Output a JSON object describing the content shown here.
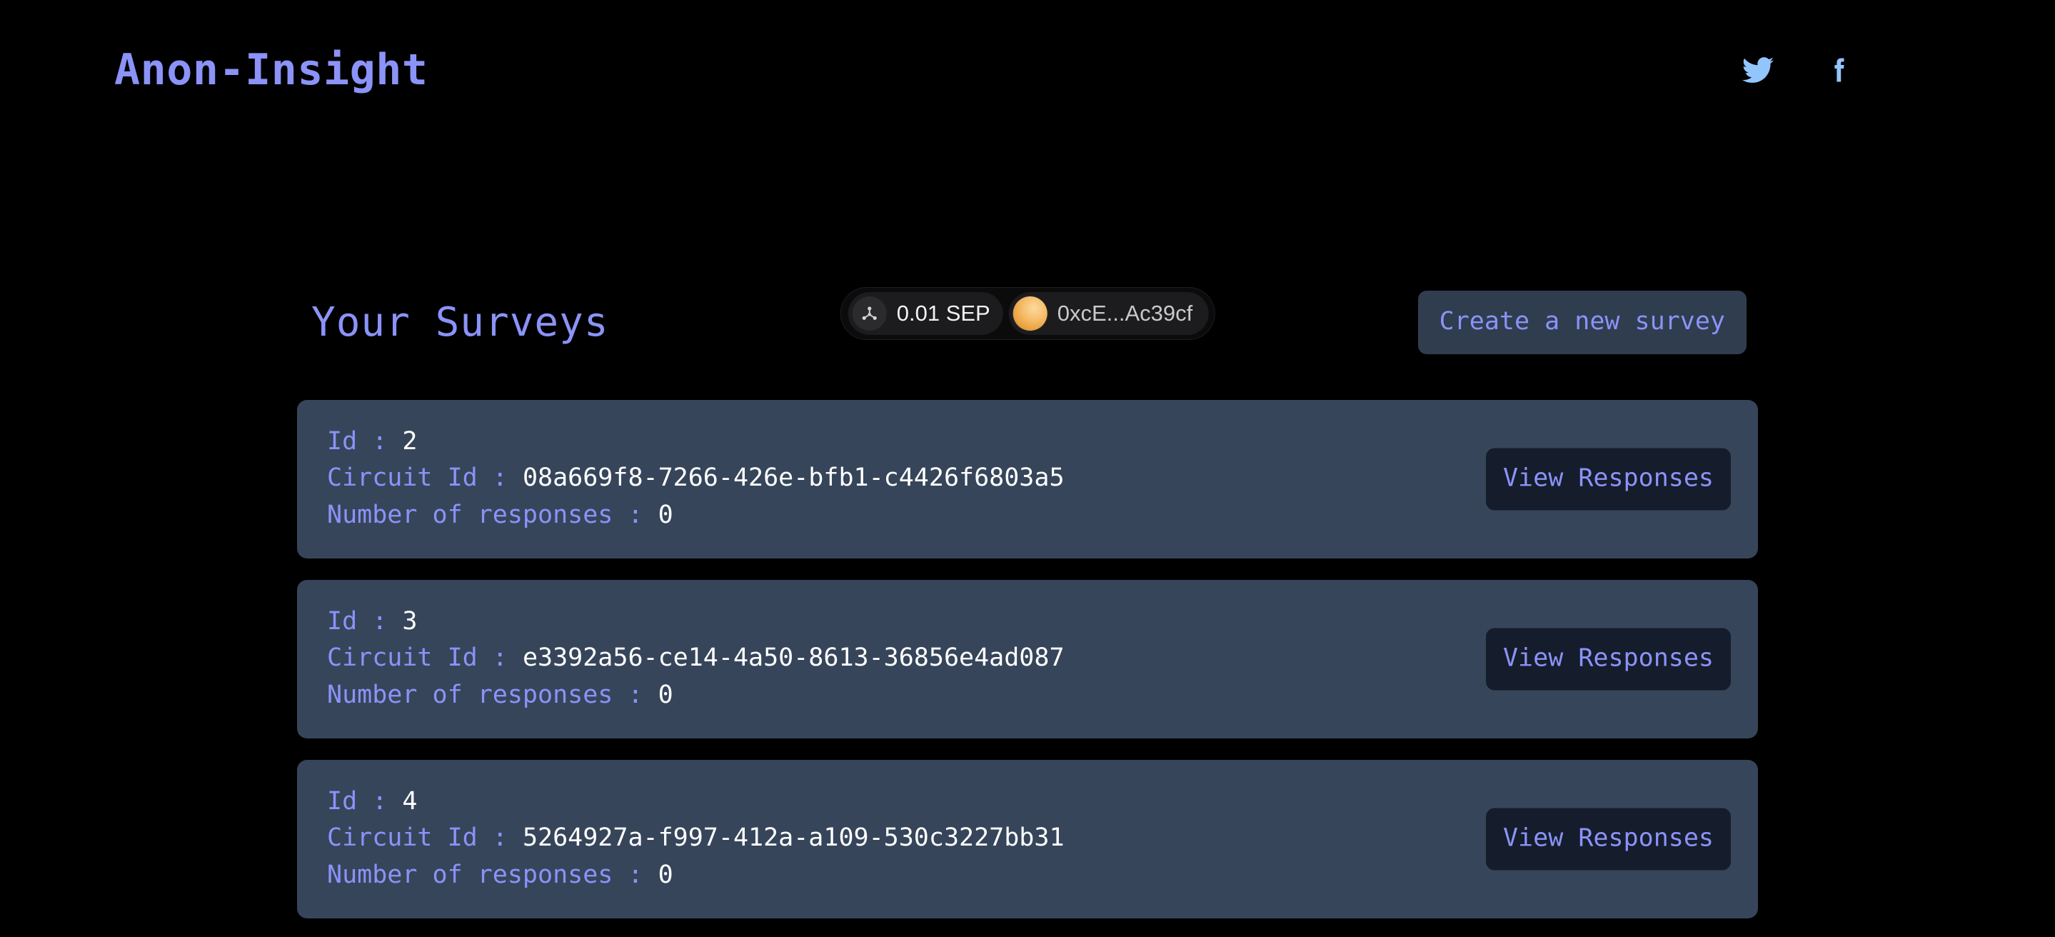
{
  "header": {
    "brand": "Anon-Insight",
    "social": [
      {
        "name": "twitter-icon",
        "label": "Twitter",
        "color": "#93c5fd"
      },
      {
        "name": "facebook-icon",
        "label": "Facebook",
        "color": "#93c5fd"
      }
    ]
  },
  "toolbar": {
    "title": "Your Surveys",
    "create_label": "Create a new survey",
    "wallet": {
      "network_icon": "network-nodes-icon",
      "balance": "0.01 SEP",
      "address": "0xcE...Ac39cf",
      "avatar_icon": "wallet-avatar"
    }
  },
  "labels": {
    "id": "Id : ",
    "circuit_id": "Circuit Id : ",
    "responses": "Number of responses : ",
    "view_responses": "View Responses"
  },
  "surveys": [
    {
      "id": "2",
      "circuit_id": "08a669f8-7266-426e-bfb1-c4426f6803a5",
      "responses": "0"
    },
    {
      "id": "3",
      "circuit_id": "e3392a56-ce14-4a50-8613-36856e4ad087",
      "responses": "0"
    },
    {
      "id": "4",
      "circuit_id": "5264927a-f997-412a-a109-530c3227bb31",
      "responses": "0"
    }
  ],
  "colors": {
    "background": "#000000",
    "accent": "#8b93f8",
    "card": "#36455a",
    "create_button": "#2f3d4f",
    "view_button": "#151c2c",
    "social": "#93c5fd",
    "value_text": "#ffffff"
  }
}
